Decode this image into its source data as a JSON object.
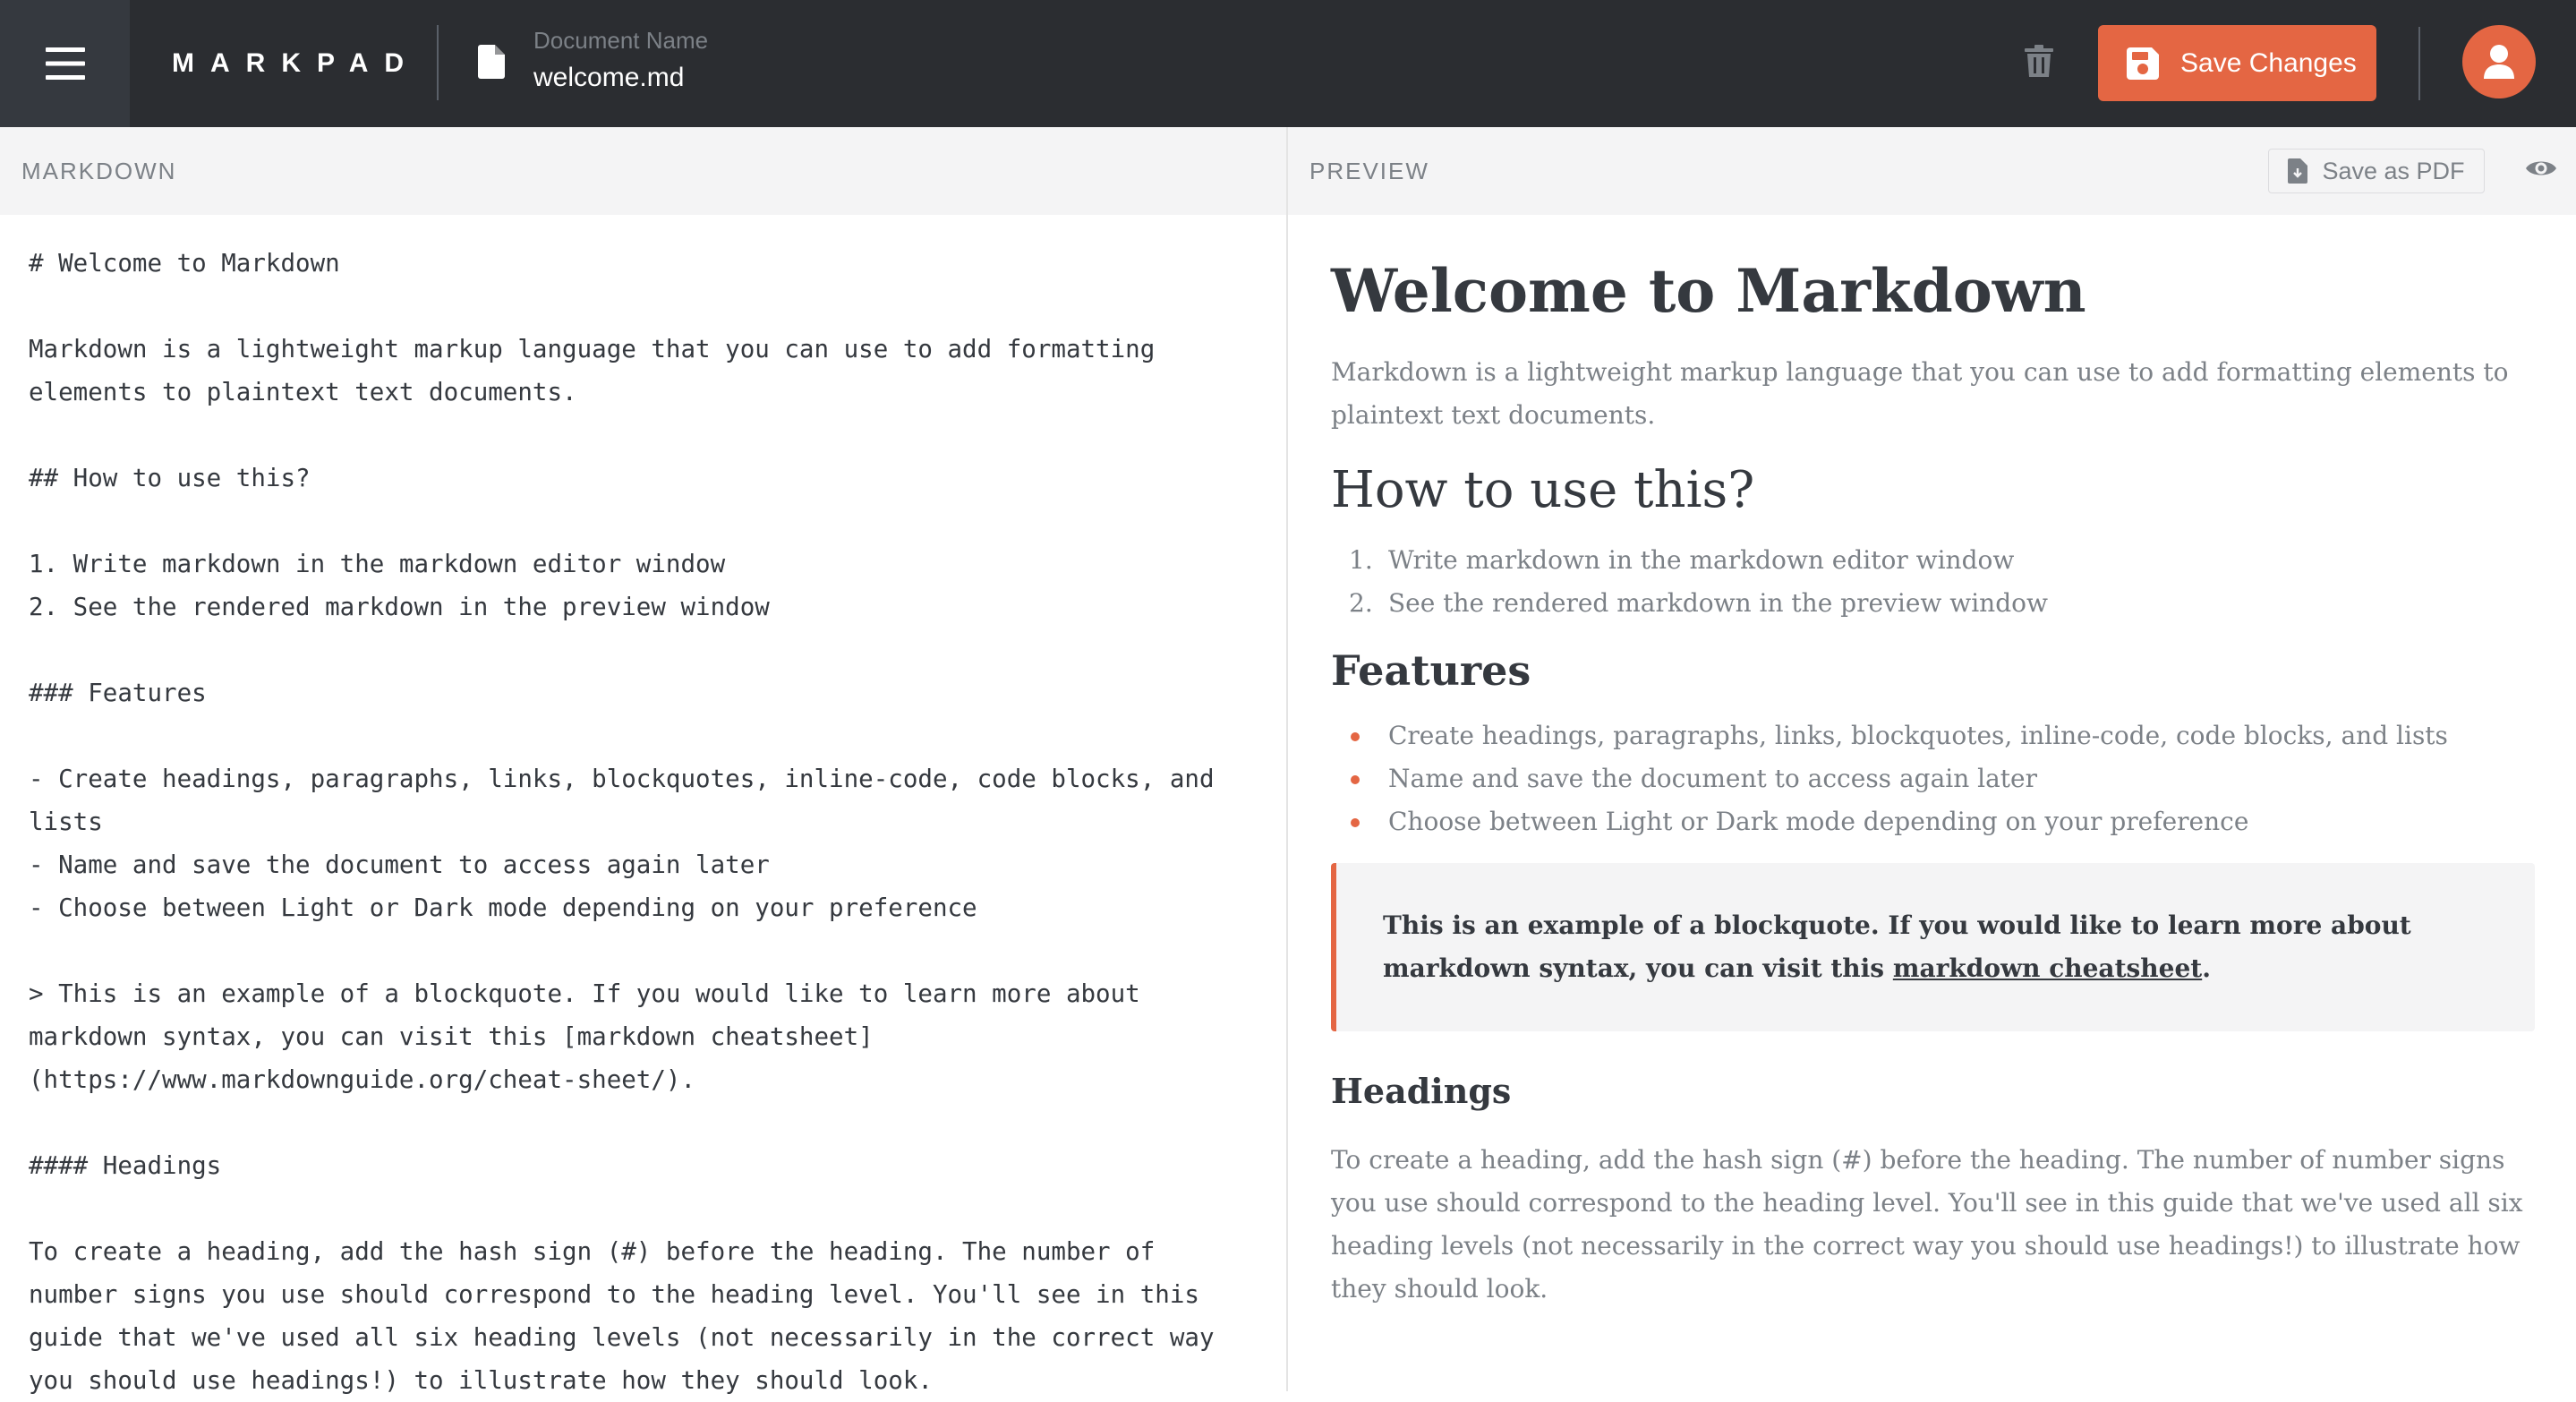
{
  "header": {
    "logo": "MARKPAD",
    "document_label": "Document Name",
    "document_name": "welcome.md",
    "save_label": "Save Changes",
    "accent_color": "#E46643",
    "icons": [
      "menu-icon",
      "document-icon",
      "trash-icon",
      "save-icon",
      "user-icon"
    ]
  },
  "markdown_pane": {
    "title": "MARKDOWN",
    "lines": [
      "# Welcome to Markdown",
      "",
      "Markdown is a lightweight markup language that you can use to add formatting",
      "elements to plaintext text documents.",
      "",
      "## How to use this?",
      "",
      "1. Write markdown in the markdown editor window",
      "2. See the rendered markdown in the preview window",
      "",
      "### Features",
      "",
      "- Create headings, paragraphs, links, blockquotes, inline-code, code blocks, and",
      "lists",
      "- Name and save the document to access again later",
      "- Choose between Light or Dark mode depending on your preference",
      "",
      "> This is an example of a blockquote. If you would like to learn more about",
      "markdown syntax, you can visit this [markdown cheatsheet]",
      "(https://www.markdownguide.org/cheat-sheet/).",
      "",
      "#### Headings",
      "",
      "To create a heading, add the hash sign (#) before the heading. The number of",
      "number signs you use should correspond to the heading level. You'll see in this",
      "guide that we've used all six heading levels (not necessarily in the correct way",
      "you should use headings!) to illustrate how they should look."
    ]
  },
  "preview_pane": {
    "title": "PREVIEW",
    "save_pdf_label": "Save as PDF",
    "h1": "Welcome to Markdown",
    "intro": "Markdown is a lightweight markup language that you can use to add formatting elements to plaintext text documents.",
    "h2": "How to use this?",
    "ordered_list": [
      {
        "num": "1.",
        "text": "Write markdown in the markdown editor window"
      },
      {
        "num": "2.",
        "text": "See the rendered markdown in the preview window"
      }
    ],
    "h3": "Features",
    "bullet_list": [
      "Create headings, paragraphs, links, blockquotes, inline-code, code blocks, and lists",
      "Name and save the document to access again later",
      "Choose between Light or Dark mode depending on your preference"
    ],
    "blockquote": {
      "before_link": "This is an example of a blockquote. If you would like to learn more about markdown syntax, you can visit this ",
      "link_text": "markdown cheatsheet",
      "after_link": "."
    },
    "h4": "Headings",
    "headings_paragraph": "To create a heading, add the hash sign (#) before the heading. The number of number signs you use should correspond to the heading level. You'll see in this guide that we've used all six heading levels (not necessarily in the correct way you should use headings!) to illustrate how they should look."
  }
}
